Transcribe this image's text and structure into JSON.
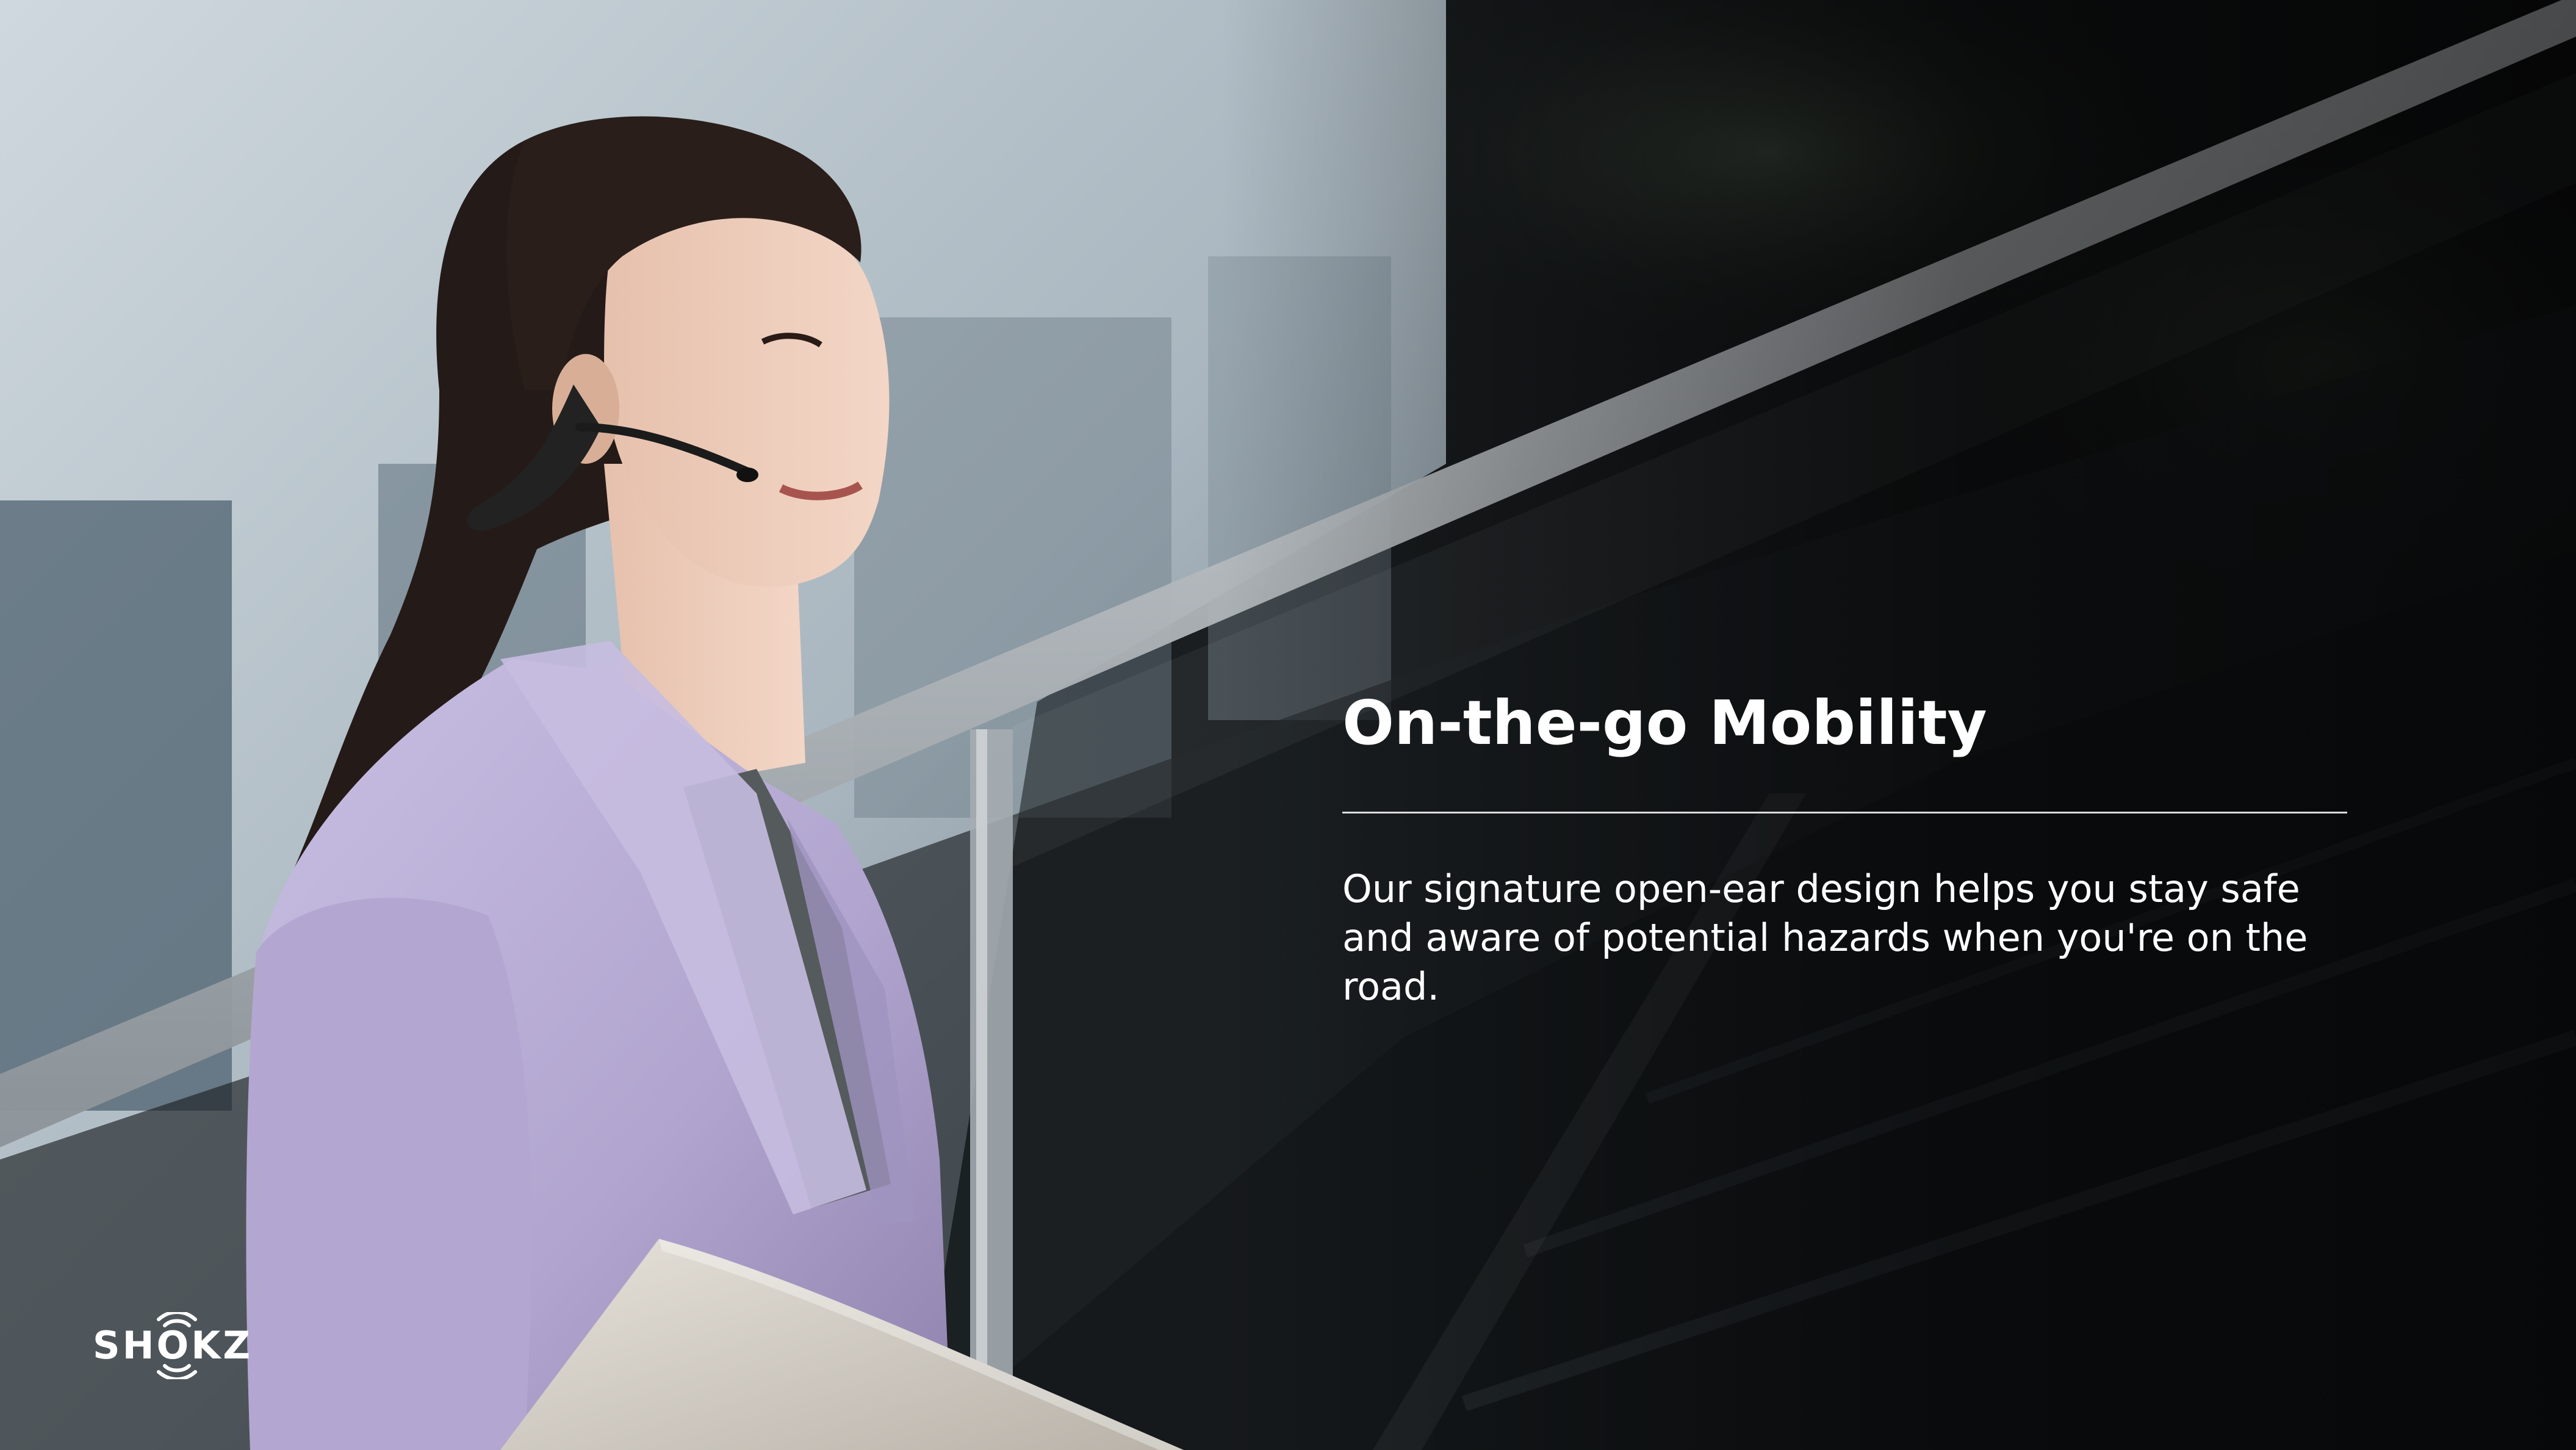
{
  "slide": {
    "headline": "On-the-go Mobility",
    "body": "Our signature open-ear design helps you stay safe and aware of potential hazards when you're on the road.",
    "logo_text": "SHOKZ"
  },
  "photo": {
    "subject": "woman-wearing-open-ear-headset-on-staircase"
  },
  "colors": {
    "text": "#ffffff",
    "blazer": "#b9aed6",
    "background_dark": "#141618",
    "wall_light": "#c8d2d8"
  }
}
